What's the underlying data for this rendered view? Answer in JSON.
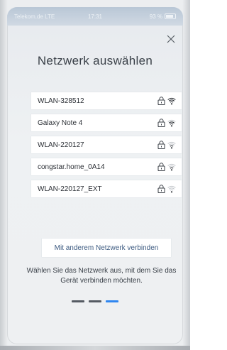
{
  "status_bar": {
    "carrier": "Telekom.de  LTE",
    "time": "17:31",
    "battery": "93 %"
  },
  "header": {
    "title": "Netzwerk auswählen",
    "close_icon": "close-icon"
  },
  "networks": [
    {
      "name": "WLAN-328512",
      "locked": true,
      "signal": "strong"
    },
    {
      "name": "Galaxy Note 4",
      "locked": true,
      "signal": "medium"
    },
    {
      "name": "WLAN-220127",
      "locked": true,
      "signal": "weak"
    },
    {
      "name": "congstar.home_0A14",
      "locked": true,
      "signal": "weak"
    },
    {
      "name": "WLAN-220127_EXT",
      "locked": true,
      "signal": "very-weak"
    }
  ],
  "actions": {
    "other_network_label": "Mit anderem Netzwerk verbinden"
  },
  "hint": {
    "text": "Wählen Sie das Netzwerk aus, mit dem Sie das Gerät verbinden möchten."
  },
  "pager": {
    "total": 3,
    "active_index": 2
  },
  "colors": {
    "accent": "#2f86f0",
    "link": "#3c5a80",
    "text": "#3a4048"
  }
}
